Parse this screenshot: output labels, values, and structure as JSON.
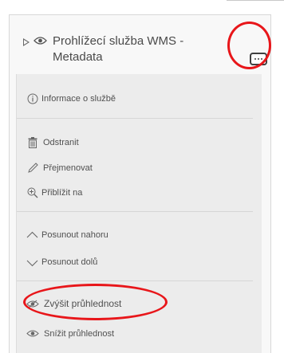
{
  "layer": {
    "title": "Prohlížecí služba WMS - Metadata",
    "icons": [
      "expand-caret-icon",
      "visibility-eye-icon",
      "more-options-icon"
    ]
  },
  "menu": {
    "info": "Informace o službě",
    "remove": "Odstranit",
    "rename": "Přejmenovat",
    "zoom_to": "Přiblížit na",
    "move_up": "Posunout nahoru",
    "move_down": "Posunout dolů",
    "increase_transparency": "Zvýšit průhlednost",
    "decrease_transparency": "Snížit průhlednost"
  },
  "colors": {
    "highlight": "#e8161a",
    "panel_bg": "#f8f8f8",
    "menu_bg": "#ececec"
  }
}
